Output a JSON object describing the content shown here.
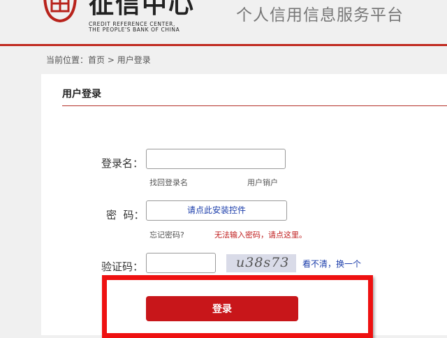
{
  "header": {
    "logo_cn": "征信中心",
    "logo_en_line1": "CREDIT REFERENCE CENTER,",
    "logo_en_line2": "THE PEOPLE'S BANK OF CHINA",
    "platform_title": "个人信用信息服务平台"
  },
  "breadcrumb": {
    "prefix": "当前位置：",
    "home": "首页",
    "separator": " > ",
    "current": "用户登录"
  },
  "form": {
    "title": "用户登录",
    "username_label": "登录名：",
    "username_value": "",
    "find_username": "找回登录名",
    "cancel_account": "用户销户",
    "password_label": "密  码：",
    "password_control_text": "请点此安装控件",
    "forgot_password": "忘记密码?",
    "cannot_input_password": "无法输入密码，请点这里。",
    "captcha_label": "验证码：",
    "captcha_value": "",
    "captcha_image_text": "u38s73",
    "refresh_captcha": "看不清，换一个",
    "login_button": "登录"
  },
  "colors": {
    "brand_red": "#c0281e",
    "button_red": "#c8161a",
    "highlight_red": "#ee1111",
    "link_blue": "#1a3caa"
  }
}
